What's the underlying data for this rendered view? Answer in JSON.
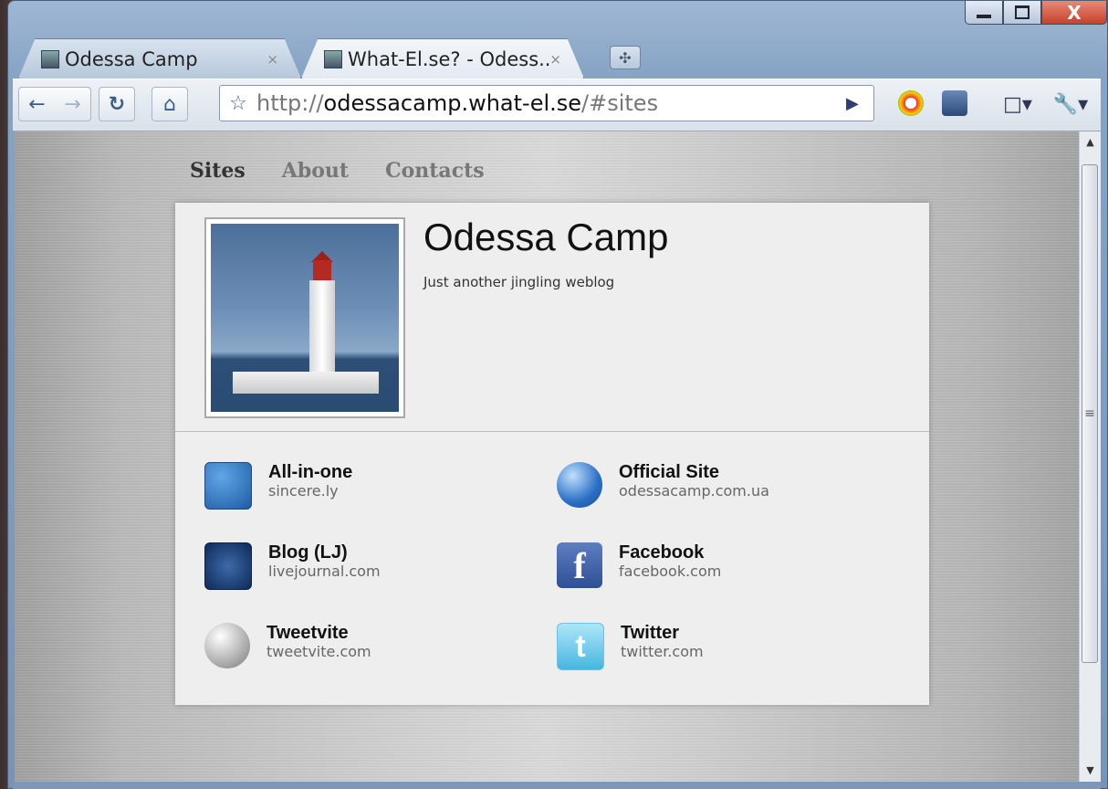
{
  "browser": {
    "tabs": [
      {
        "title": "Odessa Camp",
        "active": false
      },
      {
        "title": "What-El.se? - Odess...",
        "active": true
      }
    ],
    "tab_close_glyph": "×",
    "new_tab_glyph": "✣",
    "window_close_glyph": "X",
    "omnibox": {
      "url_prefix": "http://",
      "url_host": "odessacamp.what-el.se",
      "url_suffix": "/#sites"
    },
    "toolbar_icons": [
      "back-icon",
      "forward-icon",
      "reload-icon",
      "home-icon",
      "bookmark-star-icon",
      "go-icon",
      "seo-extension-icon",
      "user-extension-icon",
      "page-menu-icon",
      "wrench-menu-icon"
    ]
  },
  "site": {
    "nav": [
      {
        "label": "Sites",
        "active": true
      },
      {
        "label": "About",
        "active": false
      },
      {
        "label": "Contacts",
        "active": false
      }
    ],
    "title": "Odessa Camp",
    "tagline": "Just another jingling weblog",
    "links": [
      {
        "name": "All-in-one",
        "domain": "sincere.ly",
        "icon": "world-map-icon"
      },
      {
        "name": "Official Site",
        "domain": "odessacamp.com.ua",
        "icon": "globe-icon"
      },
      {
        "name": "Blog (LJ)",
        "domain": "livejournal.com",
        "icon": "livejournal-icon"
      },
      {
        "name": "Facebook",
        "domain": "facebook.com",
        "icon": "facebook-icon"
      },
      {
        "name": "Tweetvite",
        "domain": "tweetvite.com",
        "icon": "tweetvite-icon"
      },
      {
        "name": "Twitter",
        "domain": "twitter.com",
        "icon": "twitter-icon"
      }
    ]
  }
}
